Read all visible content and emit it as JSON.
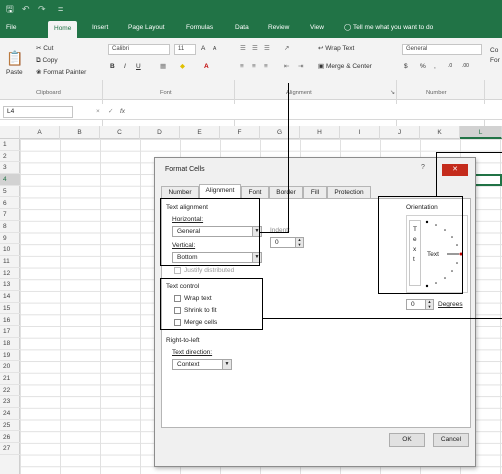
{
  "quick_access": {
    "save_icon": "save-icon",
    "undo_icon": "undo-icon",
    "redo_icon": "redo-icon",
    "customize": "="
  },
  "ribbon_tabs": [
    "File",
    "Home",
    "Insert",
    "Page Layout",
    "Formulas",
    "Data",
    "Review",
    "View"
  ],
  "tell_me": "Tell me what you want to do",
  "clipboard": {
    "cut": "Cut",
    "copy": "Copy",
    "paste": "Paste",
    "format_painter": "Format Painter",
    "group": "Clipboard"
  },
  "font": {
    "name": "Calibri",
    "size": "11",
    "bold": "B",
    "italic": "I",
    "underline": "U",
    "grow": "A",
    "shrink": "A",
    "group": "Font"
  },
  "alignment": {
    "wrap_text": "Wrap Text",
    "merge_center": "Merge & Center",
    "group": "Alignment"
  },
  "number": {
    "format": "General",
    "currency": "$",
    "percent": "%",
    "group": "Number"
  },
  "cut_off_labels": {
    "cond": "Co",
    "format": "For"
  },
  "formula_bar": {
    "name_box": "L4",
    "fx": "fx",
    "cancel": "×",
    "enter": "✓"
  },
  "columns": [
    "A",
    "B",
    "C",
    "D",
    "E",
    "F",
    "G",
    "H",
    "I",
    "J",
    "K",
    "L"
  ],
  "rows": [
    "1",
    "2",
    "3",
    "4",
    "5",
    "6",
    "7",
    "8",
    "9",
    "10",
    "11",
    "12",
    "13",
    "14",
    "15",
    "16",
    "17",
    "18",
    "19",
    "20",
    "21",
    "22",
    "23",
    "24",
    "25",
    "26",
    "27"
  ],
  "selected_column": "L",
  "selected_row": "4",
  "dialog": {
    "title": "Format Cells",
    "help": "?",
    "close": "✕",
    "tabs": [
      "Number",
      "Alignment",
      "Font",
      "Border",
      "Fill",
      "Protection"
    ],
    "active_tab": "Alignment",
    "text_alignment": {
      "heading": "Text alignment",
      "horizontal_label": "Horizontal:",
      "horizontal_value": "General",
      "indent_label": "Indent:",
      "indent_value": "0",
      "vertical_label": "Vertical:",
      "vertical_value": "Bottom",
      "justify_distributed": "Justify distributed"
    },
    "text_control": {
      "heading": "Text control",
      "wrap_text": "Wrap text",
      "shrink_to_fit": "Shrink to fit",
      "merge_cells": "Merge cells"
    },
    "rtl": {
      "heading": "Right-to-left",
      "direction_label": "Text direction:",
      "direction_value": "Context"
    },
    "orientation": {
      "heading": "Orientation",
      "vertical_text": [
        "T",
        "e",
        "x",
        "t"
      ],
      "text_label": "Text",
      "degrees_value": "0",
      "degrees_label": "Degrees"
    },
    "ok": "OK",
    "cancel": "Cancel"
  }
}
